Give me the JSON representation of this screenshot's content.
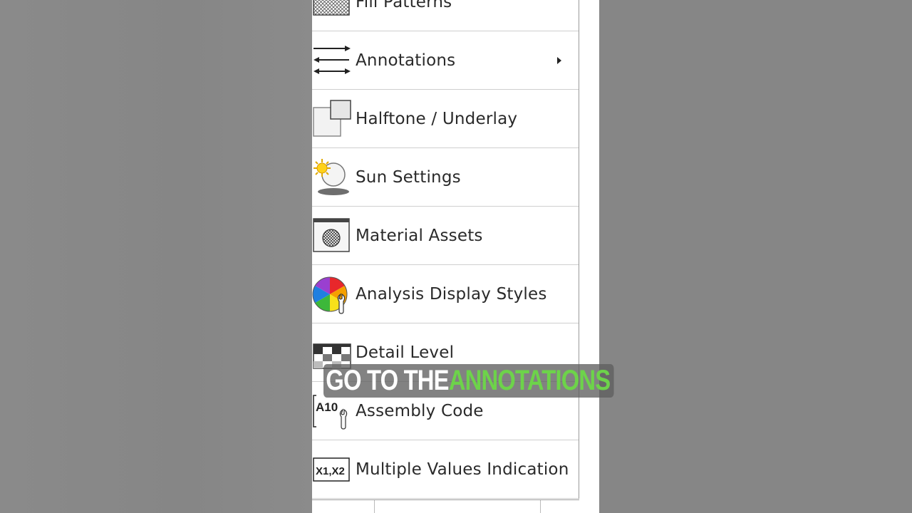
{
  "menu": {
    "items": [
      {
        "label": "Fill Patterns",
        "icon": "fill-patterns-icon"
      },
      {
        "label": "Annotations",
        "icon": "annotations-arrows-icon",
        "has_submenu": true
      },
      {
        "label": "Halftone / Underlay",
        "icon": "halftone-underlay-icon"
      },
      {
        "label": "Sun Settings",
        "icon": "sun-settings-icon"
      },
      {
        "label": "Material Assets",
        "icon": "material-assets-icon"
      },
      {
        "label": "Analysis Display Styles",
        "icon": "analysis-display-styles-icon"
      },
      {
        "label": "Detail Level",
        "icon": "detail-level-icon"
      },
      {
        "label": "Assembly Code",
        "icon": "assembly-code-icon",
        "icon_text": "A10"
      },
      {
        "label": "Multiple Values Indication",
        "icon": "multiple-values-icon",
        "icon_text": "X1,X2"
      }
    ]
  },
  "caption": {
    "part1": "GO TO THE ",
    "part2": "ANNOTATIONS",
    "highlight_color": "#6dd34a"
  }
}
